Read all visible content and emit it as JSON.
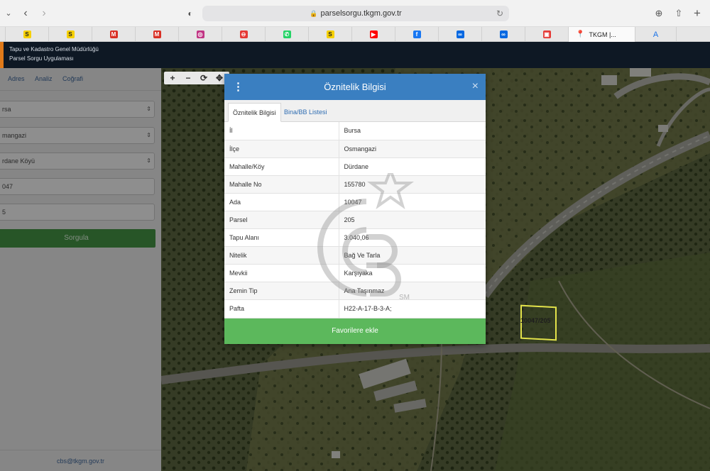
{
  "browser": {
    "url": "parselsorgu.tkgm.gov.tr",
    "active_tab_title": "TKGM |...",
    "tabs": [
      {
        "icon": "sahibinden-icon",
        "glyph": "S",
        "color": "#f6d000"
      },
      {
        "icon": "sahibinden-icon",
        "glyph": "S",
        "color": "#f6d000"
      },
      {
        "icon": "gmail-icon",
        "glyph": "M",
        "color": "#d93025"
      },
      {
        "icon": "gmail-icon",
        "glyph": "M",
        "color": "#d93025"
      },
      {
        "icon": "instagram-icon",
        "glyph": "◎",
        "color": "#c13584"
      },
      {
        "icon": "block-icon",
        "glyph": "⊖",
        "color": "#e53935"
      },
      {
        "icon": "whatsapp-icon",
        "glyph": "✆",
        "color": "#25d366"
      },
      {
        "icon": "sahibinden-icon",
        "glyph": "S",
        "color": "#f6d000"
      },
      {
        "icon": "youtube-icon",
        "glyph": "▶",
        "color": "#ff0000"
      },
      {
        "icon": "facebook-icon",
        "glyph": "f",
        "color": "#1877f2"
      },
      {
        "icon": "meta-icon",
        "glyph": "∞",
        "color": "#0668e1"
      },
      {
        "icon": "meta-icon",
        "glyph": "∞",
        "color": "#0668e1"
      },
      {
        "icon": "app-icon",
        "glyph": "▣",
        "color": "#e53935"
      }
    ]
  },
  "app_header": {
    "line1": "Tapu ve Kadastro Genel Müdürlüğü",
    "line2": "Parsel Sorgu Uygulaması"
  },
  "sidebar": {
    "tabs": [
      "Adres",
      "Analiz",
      "Coğrafi"
    ],
    "fields": [
      "rsa",
      "mangazi",
      "rdane Köyü",
      "047",
      "5"
    ],
    "submit_label": "Sorgula",
    "footer_email": "cbs@tkgm.gov.tr"
  },
  "map": {
    "parcel_label": "10047/205"
  },
  "modal": {
    "title": "Öznitelik Bilgisi",
    "tabs": [
      "Öznitelik Bilgisi",
      "Bina/BB Listesi"
    ],
    "rows": [
      {
        "key": "İl",
        "value": "Bursa"
      },
      {
        "key": "İlçe",
        "value": "Osmangazi"
      },
      {
        "key": "Mahalle/Köy",
        "value": "Dürdane"
      },
      {
        "key": "Mahalle No",
        "value": "155780"
      },
      {
        "key": "Ada",
        "value": "10047"
      },
      {
        "key": "Parsel",
        "value": "205"
      },
      {
        "key": "Tapu Alanı",
        "value": "3.040,06"
      },
      {
        "key": "Nitelik",
        "value": "Bağ Ve Tarla"
      },
      {
        "key": "Mevkii",
        "value": "Karşıyaka"
      },
      {
        "key": "Zemin Tip",
        "value": "Ana Taşınmaz"
      },
      {
        "key": "Pafta",
        "value": "H22-A-17-B-3-A;"
      }
    ],
    "favorite_button": "Favorilere ekle"
  },
  "watermark": {
    "text": "CB",
    "mark": "SM"
  }
}
